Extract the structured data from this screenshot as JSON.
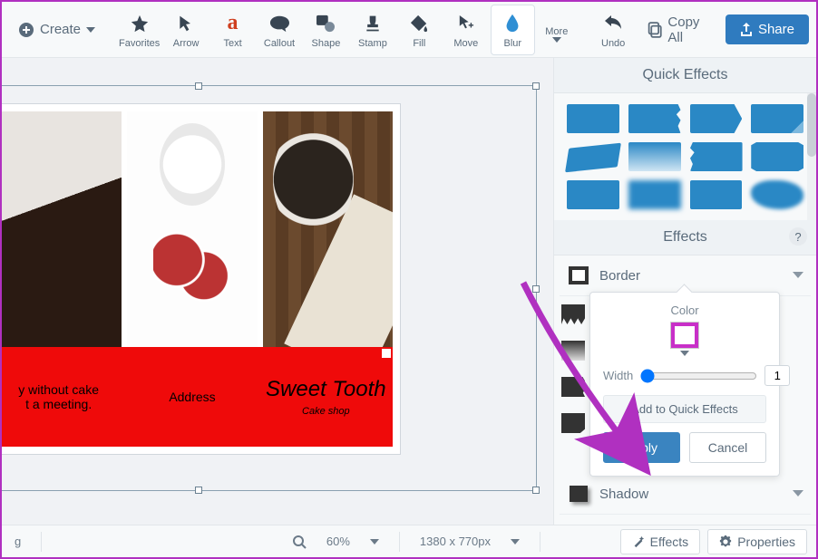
{
  "toolbar": {
    "create_label": "Create",
    "items": [
      {
        "label": "Favorites"
      },
      {
        "label": "Arrow"
      },
      {
        "label": "Text"
      },
      {
        "label": "Callout"
      },
      {
        "label": "Shape"
      },
      {
        "label": "Stamp"
      },
      {
        "label": "Fill"
      },
      {
        "label": "Move"
      },
      {
        "label": "Blur"
      },
      {
        "label": "More"
      },
      {
        "label": "Undo"
      }
    ],
    "copy_all_label": "Copy All",
    "share_label": "Share"
  },
  "canvas": {
    "red_cells": {
      "left_line1": "y without cake",
      "left_line2": "t a meeting.",
      "center": "Address",
      "right_title": "Sweet Tooth",
      "right_sub": "Cake shop"
    }
  },
  "right_panel": {
    "quick_header": "Quick Effects",
    "effects_header": "Effects",
    "help": "?",
    "border_label": "Border",
    "shadow_label": "Shadow"
  },
  "border_popup": {
    "color_label": "Color",
    "color_value": "#c82fc8",
    "width_label": "Width",
    "width_value": "1",
    "add_quick": "Add to Quick Effects",
    "apply": "Apply",
    "cancel": "Cancel"
  },
  "statusbar": {
    "left_text": "g",
    "zoom": "60%",
    "dims": "1380 x 770px"
  },
  "bottom_tabs": {
    "effects": "Effects",
    "properties": "Properties"
  }
}
